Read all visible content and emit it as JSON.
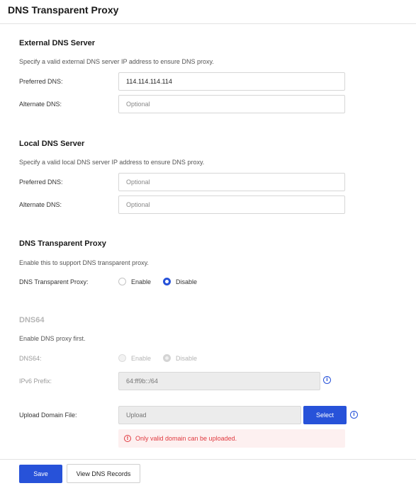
{
  "page": {
    "title": "DNS Transparent Proxy"
  },
  "external_dns": {
    "title": "External DNS Server",
    "description": "Specify a valid external DNS server IP address to ensure DNS proxy.",
    "preferred": {
      "label": "Preferred DNS:",
      "value": "114.114.114.114",
      "placeholder": ""
    },
    "alternate": {
      "label": "Alternate DNS:",
      "value": "",
      "placeholder": "Optional"
    }
  },
  "local_dns": {
    "title": "Local DNS Server",
    "description": "Specify a valid local DNS server IP address to ensure DNS proxy.",
    "preferred": {
      "label": "Preferred DNS:",
      "value": "",
      "placeholder": "Optional"
    },
    "alternate": {
      "label": "Alternate DNS:",
      "value": "",
      "placeholder": "Optional"
    }
  },
  "transparent_proxy": {
    "title": "DNS Transparent Proxy",
    "description": "Enable this to support DNS transparent proxy.",
    "label": "DNS Transparent Proxy:",
    "options": [
      "Enable",
      "Disable"
    ],
    "selected": "Disable"
  },
  "dns64": {
    "title": "DNS64",
    "description": "Enable DNS proxy first.",
    "label": "DNS64:",
    "options": [
      "Enable",
      "Disable"
    ],
    "selected": "Disable",
    "ipv6_prefix": {
      "label": "IPv6 Prefix:",
      "value": "",
      "placeholder": "64:ff9b::/64"
    }
  },
  "upload": {
    "label": "Upload Domain File:",
    "placeholder": "Upload",
    "select_label": "Select",
    "error": "Only valid domain can be uploaded."
  },
  "footer": {
    "save_label": "Save",
    "view_records_label": "View DNS Records"
  },
  "icons": {
    "info": "info-icon",
    "error": "error-icon"
  },
  "colors": {
    "accent": "#2752d9",
    "error": "#e0383e",
    "error_bg": "#fdf0f0"
  }
}
